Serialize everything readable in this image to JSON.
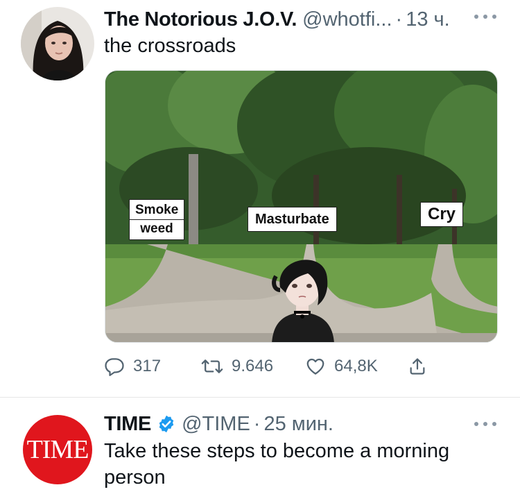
{
  "tweets": [
    {
      "author_name": "The Notorious J.O.V.",
      "handle": "@whotfi...",
      "separator": "·",
      "time": "13 ч.",
      "text": "the crossroads",
      "media": {
        "labels": {
          "smoke_line1": "Smoke",
          "smoke_line2": "weed",
          "masturbate": "Masturbate",
          "cry": "Cry"
        }
      },
      "stats": {
        "replies": "317",
        "retweets": "9.646",
        "likes": "64,8K"
      }
    },
    {
      "author_name": "TIME",
      "avatar_text": "TIME",
      "handle": "@TIME",
      "separator": "·",
      "time": "25 мин.",
      "text": "Take these steps to become a morning person"
    }
  ],
  "colors": {
    "secondary_text": "#536471",
    "time_brand_red": "#e0161d",
    "verified_blue": "#1d9bf0"
  },
  "icons": [
    "reply-icon",
    "retweet-icon",
    "like-icon",
    "share-icon",
    "more-icon",
    "verified-icon"
  ]
}
